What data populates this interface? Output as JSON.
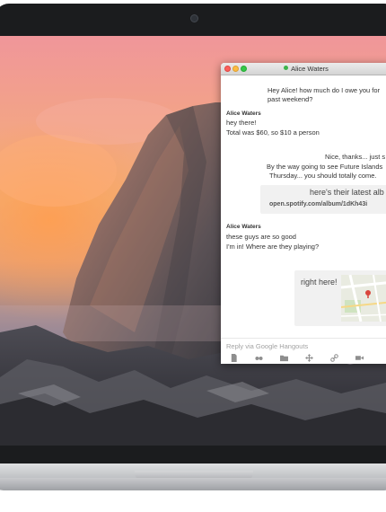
{
  "window": {
    "title": "Alice Waters",
    "presence_color": "#3cb44c"
  },
  "messages": {
    "out1_line1": "Hey Alice! how much do I owe you for",
    "out1_line2": "past weekend?",
    "in1_sender": "Alice Waters",
    "in1_line1": "hey there!",
    "in1_line2": "Total was $60, so $10 a person",
    "out2_line1": "Nice, thanks... just s",
    "out2_line2": "By the way going to see Future Islands",
    "out2_line3": "Thursday... you should totally come.",
    "card_title": "here's their latest alb",
    "card_link": "open.spotify.com/album/1dKh43i",
    "in2_sender": "Alice Waters",
    "in2_line1": "these guys are so good",
    "in2_line2": "I'm in! Where are they playing?",
    "location_label": "right here!"
  },
  "reply": {
    "placeholder": "Reply via Google Hangouts"
  },
  "toolbar": {
    "icons": [
      "document-icon",
      "sunglasses-icon",
      "folder-icon",
      "move-icon",
      "link-icon",
      "video-camera-icon"
    ]
  },
  "colors": {
    "traffic_close": "#fc605c",
    "traffic_minimize": "#fdbc40",
    "traffic_maximize": "#34c84a"
  }
}
